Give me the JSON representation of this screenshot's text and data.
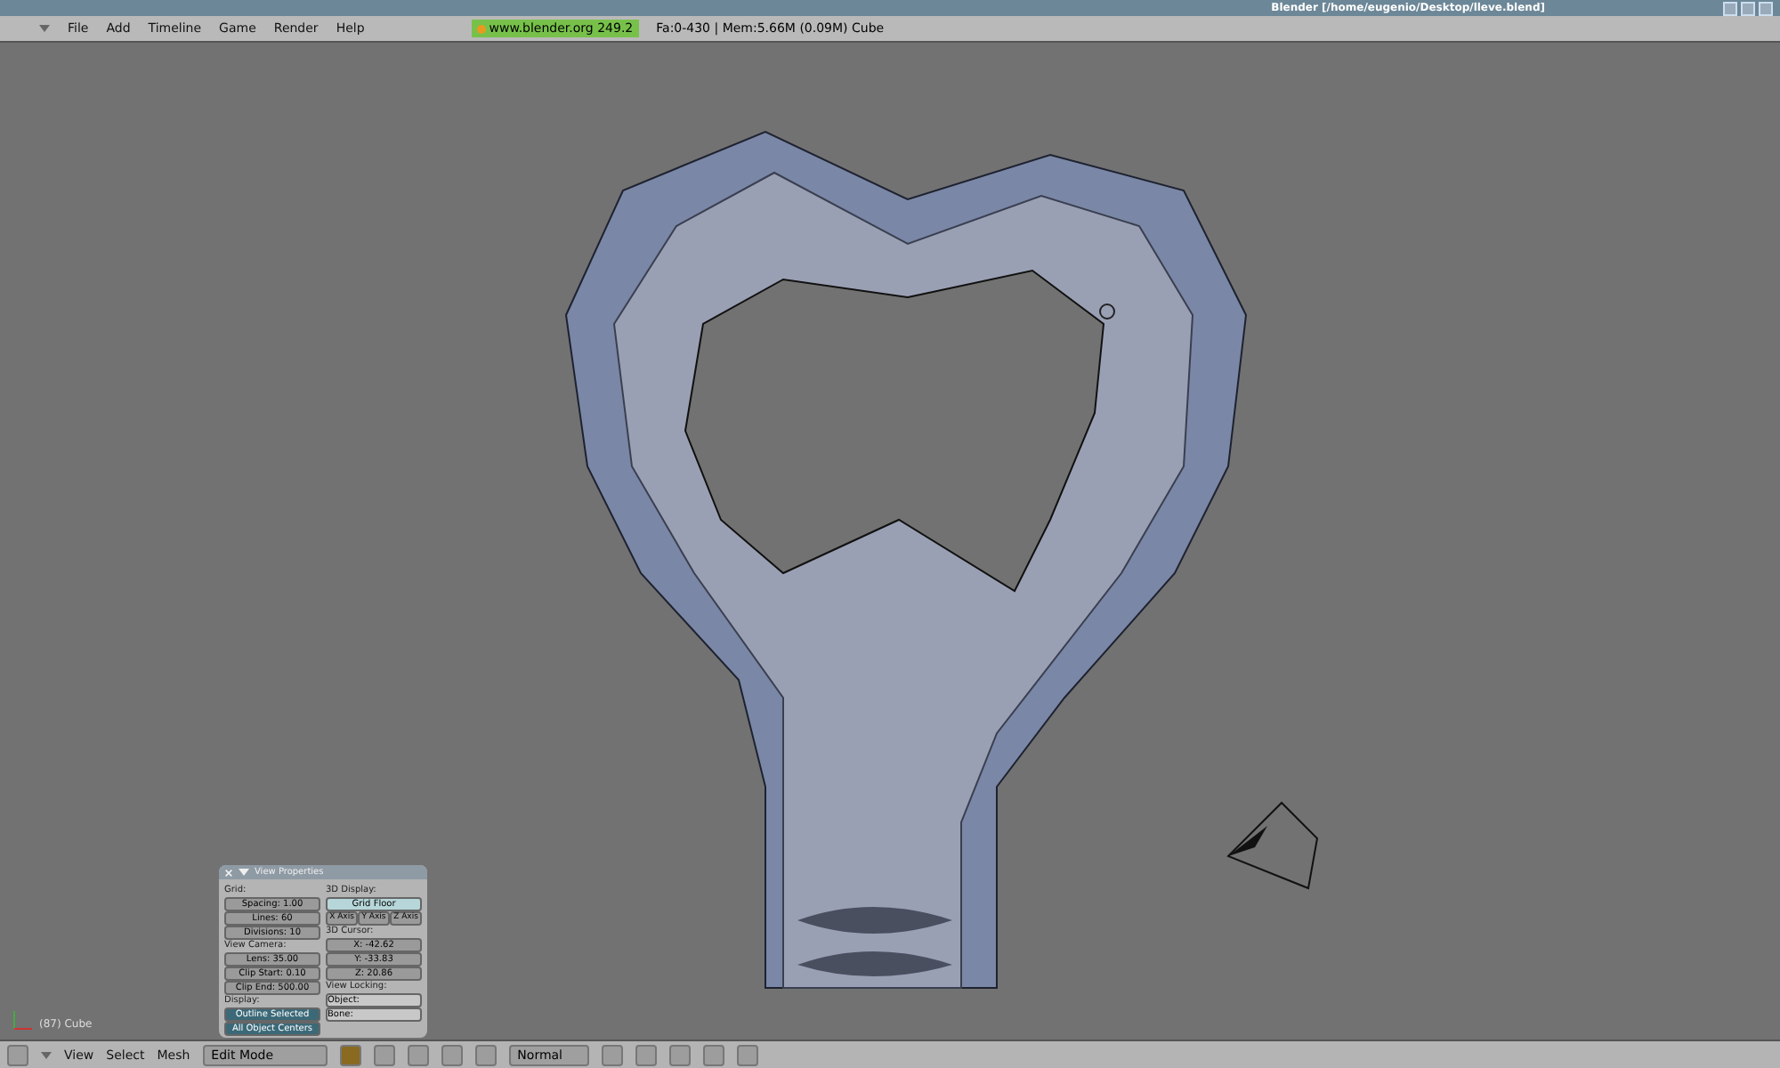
{
  "window": {
    "title": "Blender [/home/eugenio/Desktop/lleve.blend]"
  },
  "menu": [
    "File",
    "Add",
    "Timeline",
    "Game",
    "Render",
    "Help"
  ],
  "info": {
    "version": "www.blender.org 249.2",
    "stats": "Fa:0-430 | Mem:5.66M (0.09M) Cube"
  },
  "viewport": {
    "object_label": "(87) Cube"
  },
  "view_properties": {
    "title": "View Properties",
    "grid": {
      "label": "Grid:",
      "fields": [
        "Spacing: 1.00",
        "Lines: 60",
        "Divisions: 10"
      ]
    },
    "camera": {
      "label": "View Camera:",
      "fields": [
        "Lens: 35.00",
        "Clip Start: 0.10",
        "Clip End: 500.00"
      ]
    },
    "display": {
      "label": "Display:",
      "toggles": [
        {
          "label": "Outline Selected",
          "selected": true
        },
        {
          "label": "All Object Centers",
          "selected": true
        }
      ]
    },
    "display_3d": {
      "label": "3D Display:",
      "grid_floor": {
        "label": "Grid Floor",
        "selected": true
      },
      "axes": [
        {
          "label": "X Axis",
          "selected": false
        },
        {
          "label": "Y Axis",
          "selected": false
        },
        {
          "label": "Z Axis",
          "selected": false
        }
      ]
    },
    "cursor": {
      "label": "3D Cursor:",
      "fields": [
        "X: -42.62",
        "Y: -33.83",
        "Z: 20.86"
      ]
    },
    "locking": {
      "label": "View Locking:",
      "fields": [
        "Object:",
        "Bone:"
      ]
    }
  },
  "header": {
    "menus": [
      "View",
      "Select",
      "Mesh"
    ],
    "mode": "Edit Mode",
    "shading": "Normal"
  }
}
